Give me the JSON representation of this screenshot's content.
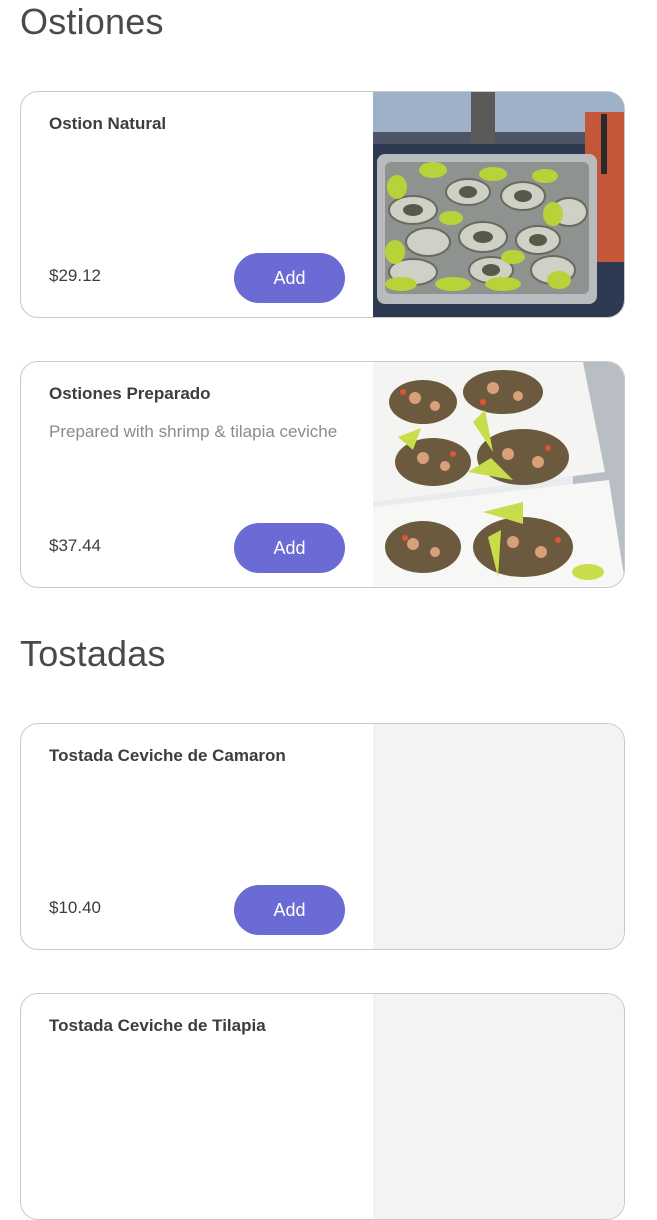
{
  "sections": [
    {
      "title": "Ostiones",
      "items": [
        {
          "name": "Ostion Natural",
          "description": "",
          "price": "$29.12",
          "add_label": "Add",
          "image": "oysters-with-lime-photo"
        },
        {
          "name": "Ostiones Preparado",
          "description": "Prepared with shrimp & tilapia ceviche",
          "price": "$37.44",
          "add_label": "Add",
          "image": "prepared-oysters-photo"
        }
      ]
    },
    {
      "title": "Tostadas",
      "items": [
        {
          "name": "Tostada Ceviche de Camaron",
          "description": "",
          "price": "$10.40",
          "add_label": "Add",
          "image": "placeholder"
        },
        {
          "name": "Tostada Ceviche de Tilapia",
          "description": "",
          "price": "",
          "add_label": "",
          "image": "placeholder"
        }
      ]
    }
  ],
  "colors": {
    "accent": "#6b6bd5",
    "card_border": "#c9c9c9",
    "placeholder_bg": "#f3f3f3"
  }
}
